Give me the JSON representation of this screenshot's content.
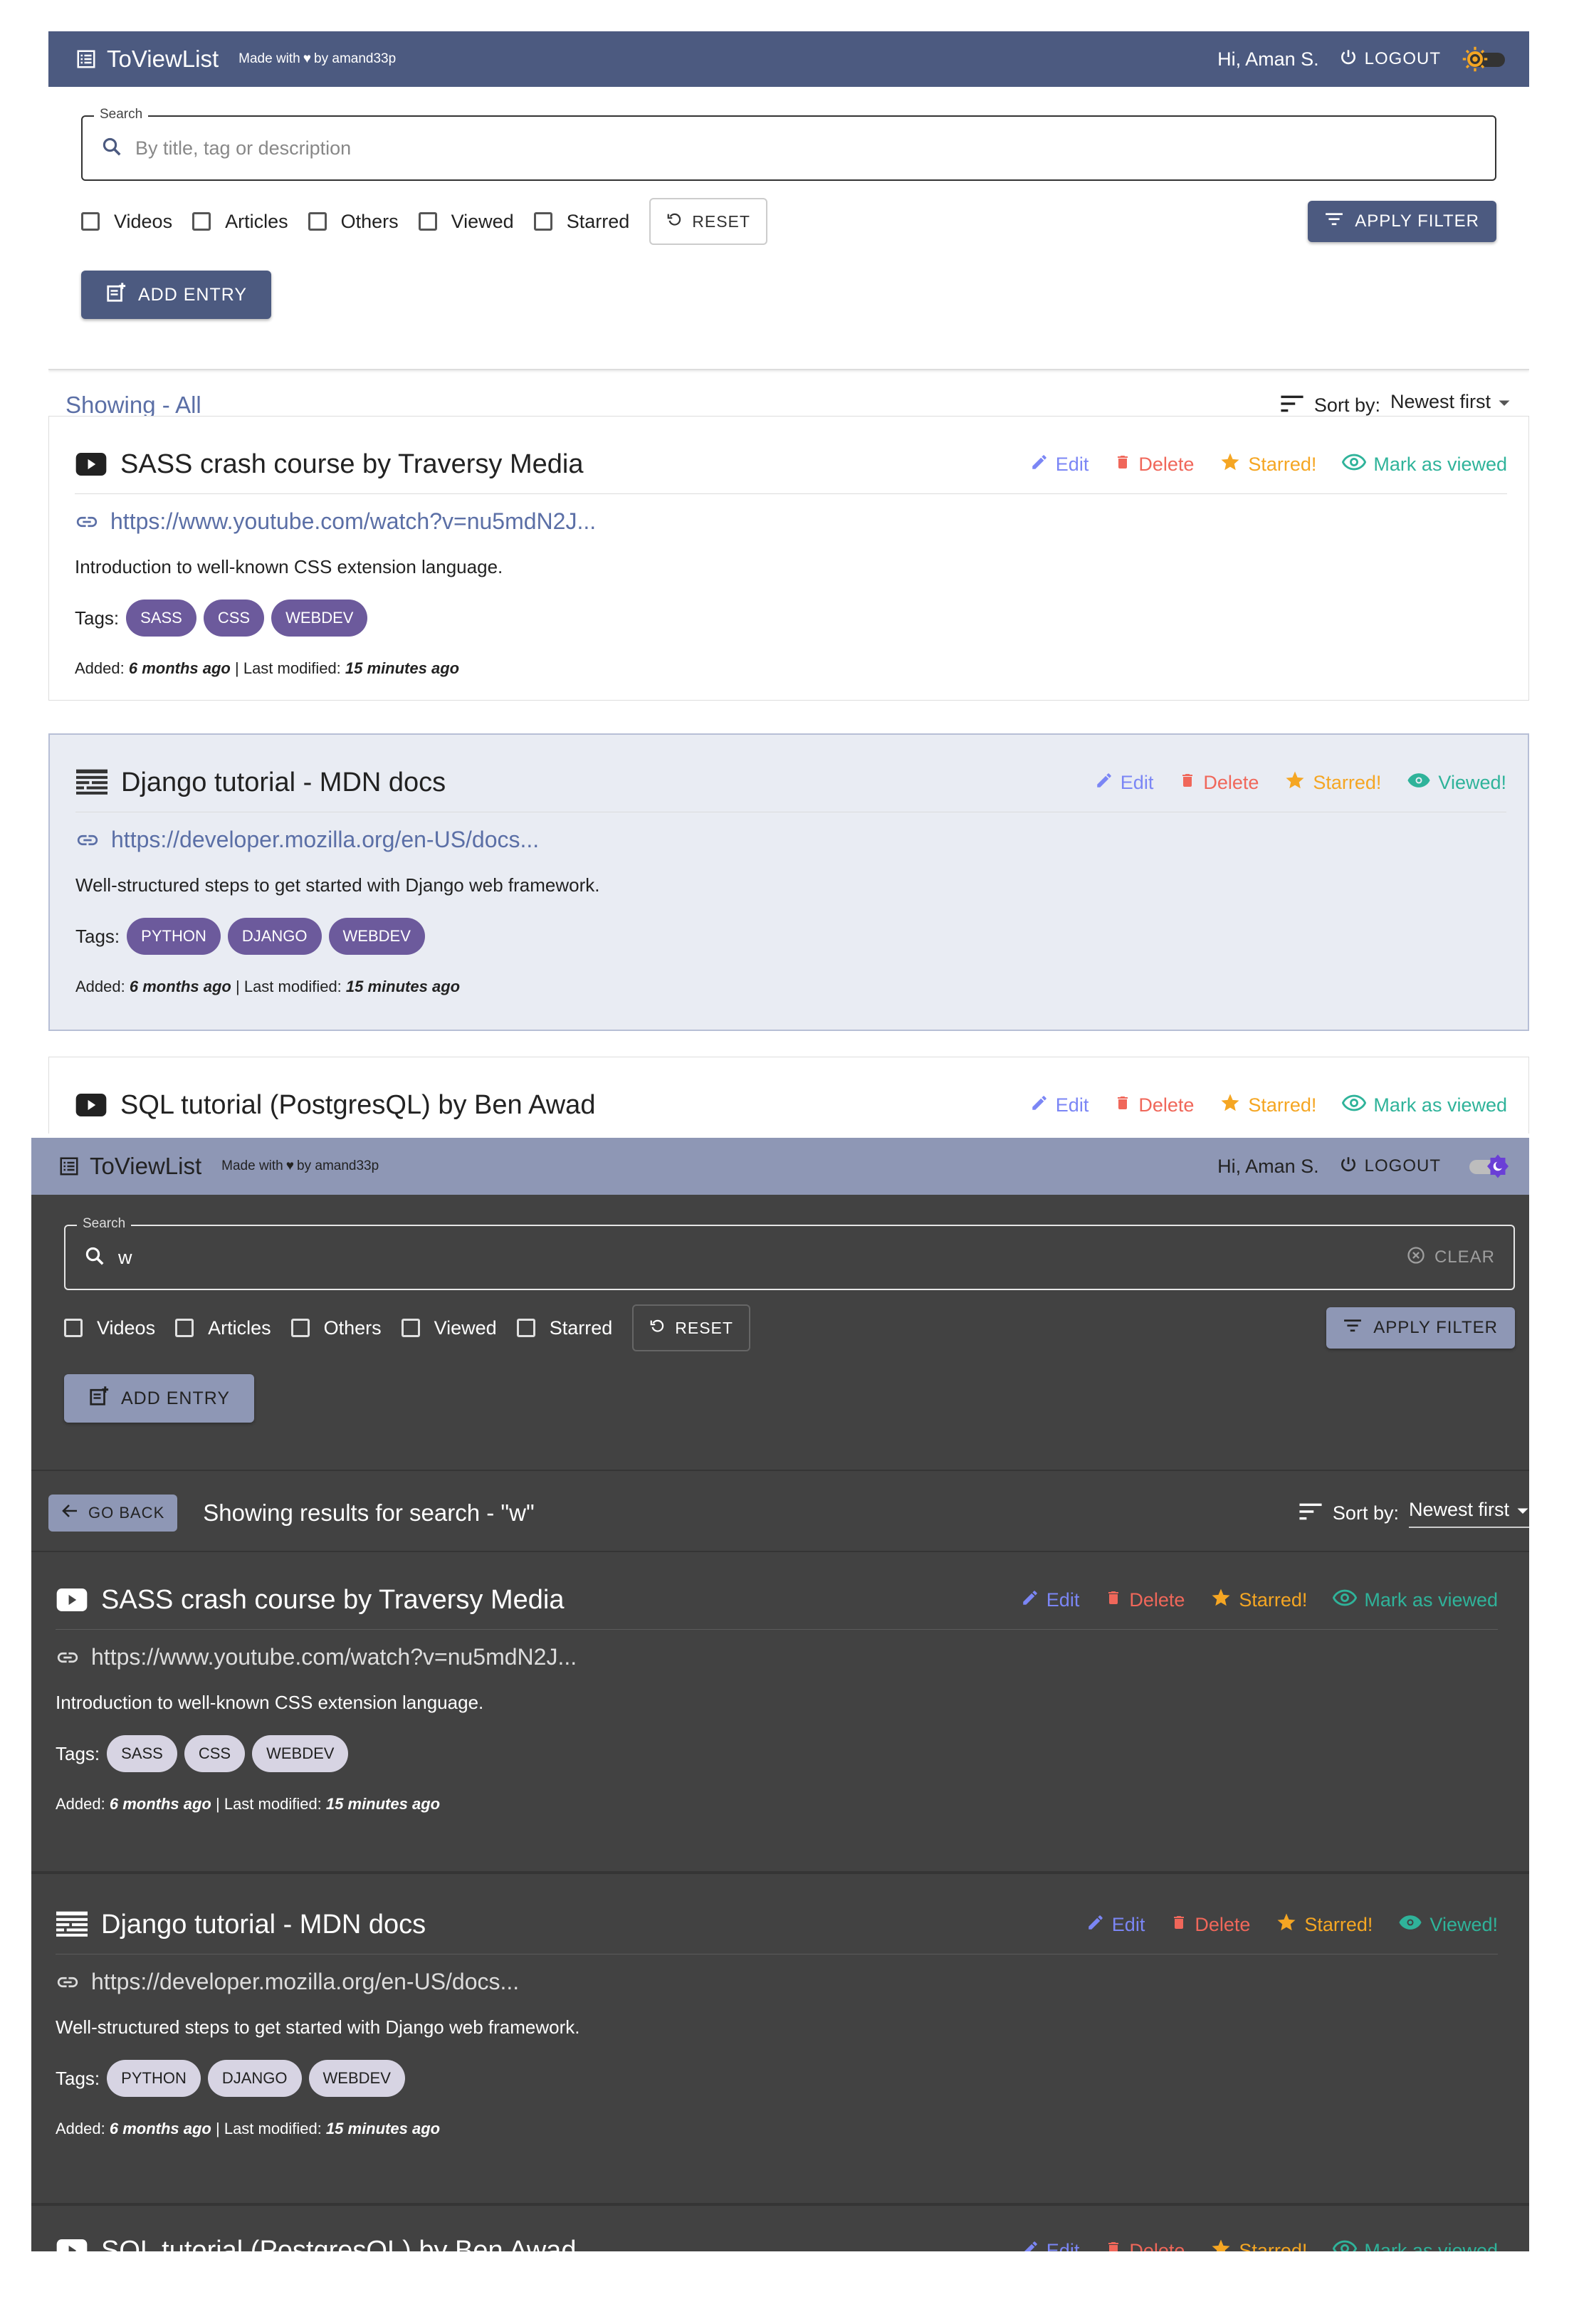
{
  "app": {
    "title": "ToViewList",
    "made_with_pre": "Made with",
    "made_with_post": "by amand33p",
    "greeting": "Hi, Aman S.",
    "logout": "LOGOUT"
  },
  "filters": {
    "search_legend": "Search",
    "search_placeholder": "By title, tag or description",
    "dark_search_value": "w",
    "clear": "CLEAR",
    "checkboxes": [
      "Videos",
      "Articles",
      "Others",
      "Viewed",
      "Starred"
    ],
    "reset": "RESET",
    "apply": "APPLY FILTER",
    "add_entry": "ADD ENTRY"
  },
  "light_view": {
    "showing": "Showing - All"
  },
  "dark_view": {
    "go_back": "GO BACK",
    "showing": "Showing results for search - \"w\""
  },
  "sort": {
    "label": "Sort by:",
    "value": "Newest first"
  },
  "actions": {
    "edit": "Edit",
    "delete": "Delete",
    "starred": "Starred!",
    "mark_viewed": "Mark as viewed",
    "viewed": "Viewed!"
  },
  "labels": {
    "tags": "Tags:",
    "added": "Added:",
    "last_modified": "Last modified:"
  },
  "entries": [
    {
      "title": "SASS crash course by Traversy Media",
      "icon": "youtube-icon",
      "url": "https://www.youtube.com/watch?v=nu5mdN2J...",
      "description": "Introduction to well-known CSS extension language.",
      "tags": [
        "SASS",
        "CSS",
        "WEBDEV"
      ],
      "added": "6 months ago",
      "modified": "15 minutes ago",
      "starred": true,
      "viewed": false
    },
    {
      "title": "Django tutorial - MDN docs",
      "icon": "article-icon",
      "url": "https://developer.mozilla.org/en-US/docs...",
      "description": "Well-structured steps to get started with Django web framework.",
      "tags": [
        "PYTHON",
        "DJANGO",
        "WEBDEV"
      ],
      "added": "6 months ago",
      "modified": "15 minutes ago",
      "starred": true,
      "viewed": true
    },
    {
      "title": "SQL tutorial (PostgresQL) by Ben Awad",
      "icon": "youtube-icon",
      "starred": true,
      "viewed": false
    }
  ],
  "colors": {
    "appbar_light": "#4c5a80",
    "appbar_dark": "#8e97b5",
    "dark_bg": "#424242",
    "edit": "#7b86f5",
    "delete": "#f0675a",
    "star": "#f5a623",
    "view": "#2fb39a",
    "tag_light": "#6c5a9c",
    "tag_dark": "#d7d4e3"
  }
}
